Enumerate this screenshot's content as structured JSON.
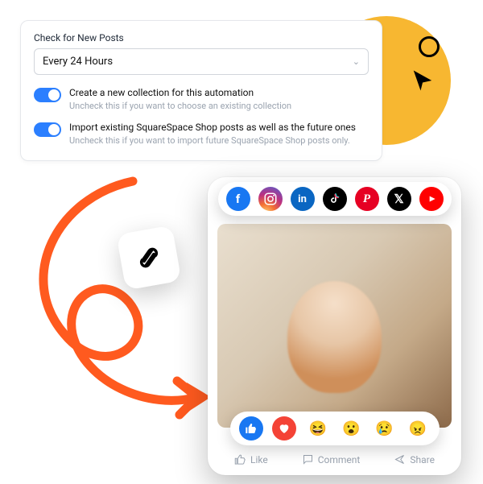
{
  "settings": {
    "check_label": "Check for New Posts",
    "interval_value": "Every 24 Hours",
    "toggle1": {
      "title": "Create a new collection for this automation",
      "desc": "Uncheck this if you want to choose an existing collection"
    },
    "toggle2": {
      "title": "Import existing SquareSpace Shop posts as well as the future ones",
      "desc": "Uncheck this if you want to import future SquareSpace Shop posts only."
    }
  },
  "social": {
    "fb": "f",
    "li": "in",
    "pn": "P",
    "x": "𝕏"
  },
  "actions": {
    "like": "Like",
    "comment": "Comment",
    "share": "Share"
  },
  "reactions": {
    "laugh": "😆",
    "wow": "😮",
    "sad": "😢",
    "angry": "😠"
  }
}
